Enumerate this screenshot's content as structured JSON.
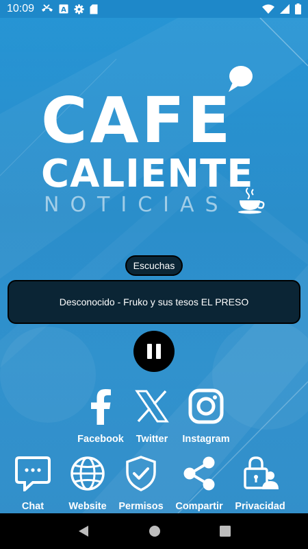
{
  "status_bar": {
    "time": "10:09",
    "left_icons": [
      "missed-call-icon",
      "a-icon",
      "settings-icon",
      "sd-card-icon"
    ],
    "right_icons": [
      "wifi-icon",
      "signal-icon",
      "battery-icon"
    ]
  },
  "logo": {
    "line1": "CAFE",
    "line2": "CALIENTE",
    "line3": "NOTICIAS"
  },
  "player": {
    "listen_label": "Escuchas",
    "track": "Desconocido - Fruko y sus tesos EL PRESO",
    "state": "playing"
  },
  "social": [
    {
      "label": "Facebook",
      "icon": "facebook-icon"
    },
    {
      "label": "Twitter",
      "icon": "x-icon"
    },
    {
      "label": "Instagram",
      "icon": "instagram-icon"
    }
  ],
  "menu": [
    {
      "label": "Chat",
      "icon": "chat-icon"
    },
    {
      "label": "Website",
      "icon": "globe-icon"
    },
    {
      "label": "Permisos",
      "icon": "shield-check-icon"
    },
    {
      "label": "Compartir",
      "icon": "share-icon"
    },
    {
      "label": "Privacidad",
      "icon": "privacy-lock-icon"
    }
  ],
  "nav_bar": {
    "buttons": [
      "back-icon",
      "home-icon",
      "recents-icon"
    ]
  },
  "colors": {
    "background": "#1b8fd2",
    "status_bar": "#1e88c9",
    "panel": "#0b2535",
    "text": "#ffffff"
  }
}
